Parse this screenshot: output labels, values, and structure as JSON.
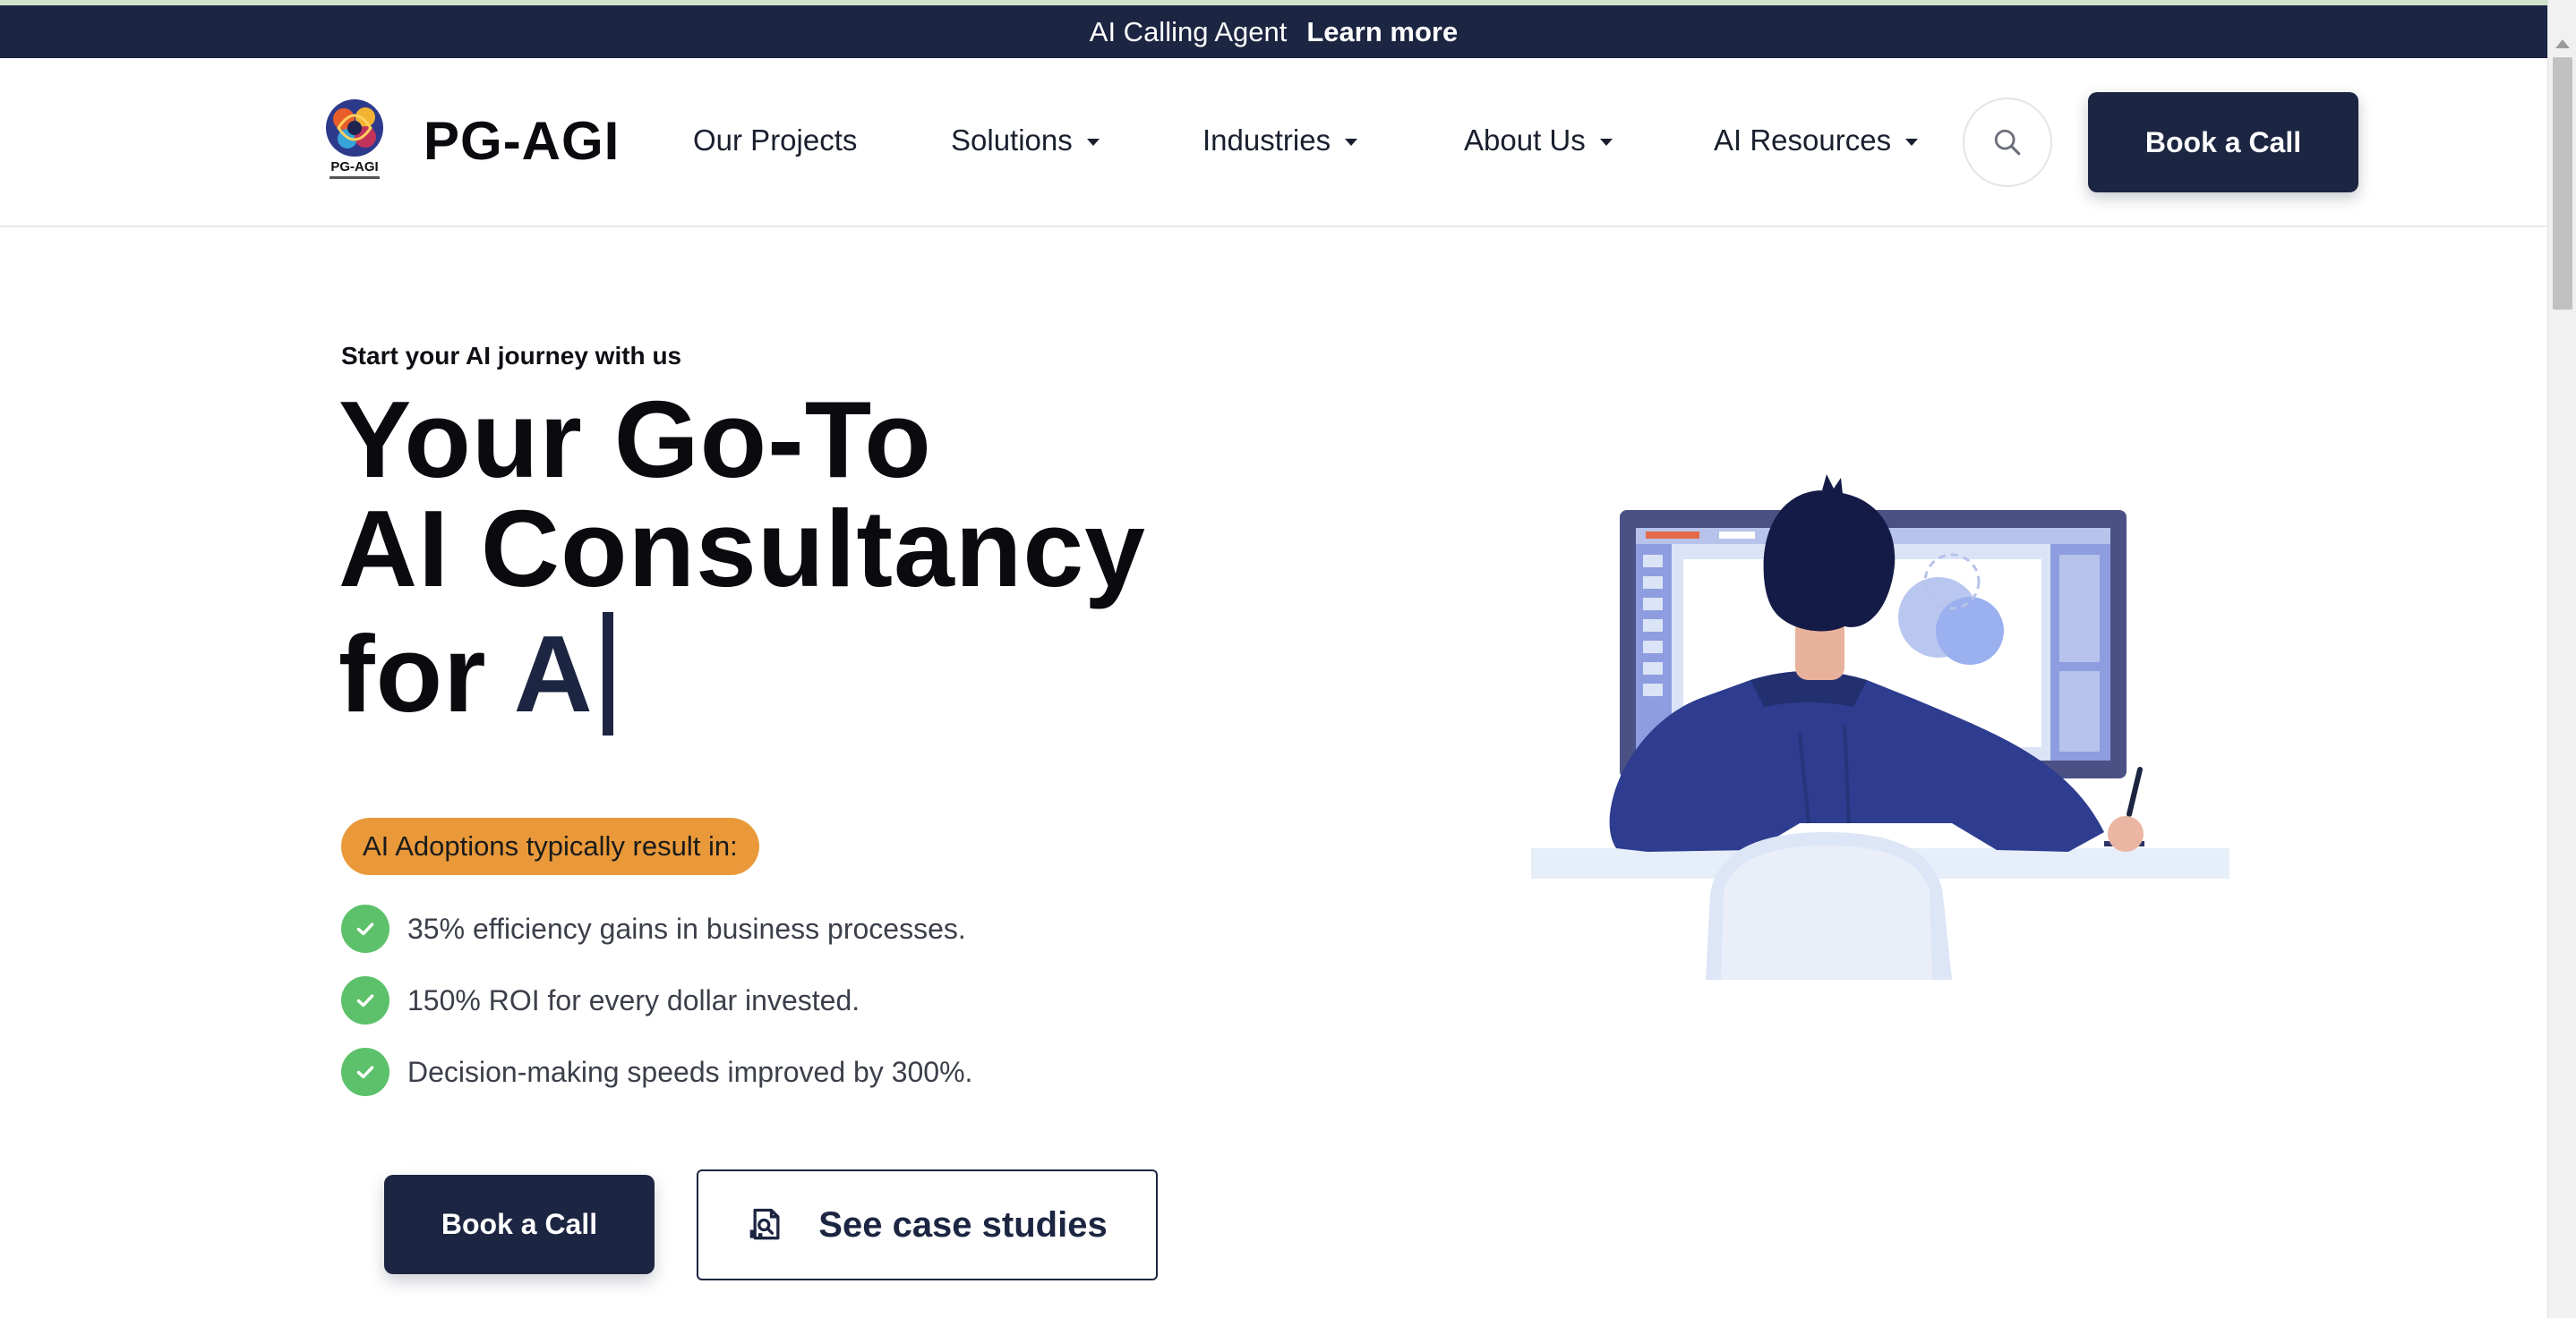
{
  "announcement": {
    "text": "AI Calling Agent",
    "link": "Learn more"
  },
  "nav": {
    "brand": "PG-AGI",
    "logo_text": "PG-AGI",
    "items": [
      {
        "label": "Our Projects"
      },
      {
        "label": "Solutions"
      },
      {
        "label": "Industries"
      },
      {
        "label": "About Us"
      },
      {
        "label": "AI Resources"
      }
    ],
    "cta": "Book a Call",
    "search_icon": "search-icon"
  },
  "hero": {
    "eyebrow": "Start your AI journey with us",
    "line1": "Your Go-To",
    "line2": "AI Consultancy",
    "line3_prefix": "for",
    "typed": "A",
    "badge": "AI Adoptions typically result in:",
    "bullets": [
      "35% efficiency gains in business processes.",
      "150% ROI for every dollar invested.",
      "Decision-making speeds improved by 300%."
    ],
    "primary_cta": "Book a Call",
    "secondary_cta": "See case studies"
  },
  "colors": {
    "navy": "#1c2541",
    "badge_orange": "#e9993a",
    "check_green": "#5cc16a"
  }
}
